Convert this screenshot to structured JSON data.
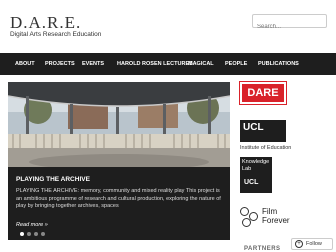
{
  "header": {
    "title": "D.A.R.E.",
    "description": "Digital Arts Research Education",
    "search_placeholder": "Search..."
  },
  "nav": {
    "items": [
      {
        "label": "About"
      },
      {
        "label": "Projects"
      },
      {
        "label": "Events"
      },
      {
        "label": "Harold Rosen Lectures"
      },
      {
        "label": "Magical"
      },
      {
        "label": "People"
      },
      {
        "label": "Publications"
      }
    ]
  },
  "feature": {
    "title": "Playing the Archive",
    "text": "PLAYING THE ARCHIVE: memory, community and mixed reality play This project is an ambitious programme of research and cultural production, exploring the nature of play by bringing together archives, spaces",
    "read_more": "Read more »",
    "slides": 4,
    "active_slide": 1
  },
  "sidebar": {
    "dare_logo": "DARE",
    "ucl_word": "UCL",
    "ucl_sub": "Institute of Education",
    "knowledge_lab": "Knowledge Lab",
    "knowledge_ucl": "UCL",
    "bfi_text": "Film Forever",
    "partners": "PARTNERS"
  },
  "follow": {
    "label": "Follow"
  },
  "colors": {
    "nav_bg": "#1e1e1e",
    "dare_red": "#d9222a",
    "feature_bg": "#1e1e1e"
  }
}
